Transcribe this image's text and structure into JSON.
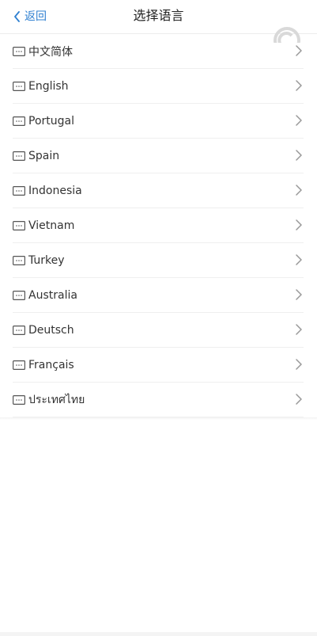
{
  "header": {
    "back_label": "返回",
    "title": "选择语言"
  },
  "languages": [
    {
      "label": "中文简体"
    },
    {
      "label": "English"
    },
    {
      "label": "Portugal"
    },
    {
      "label": "Spain"
    },
    {
      "label": "Indonesia"
    },
    {
      "label": "Vietnam"
    },
    {
      "label": "Turkey"
    },
    {
      "label": "Australia"
    },
    {
      "label": "Deutsch"
    },
    {
      "label": "Français"
    },
    {
      "label": "ประเทศไทย"
    }
  ],
  "colors": {
    "accent": "#2f80d1",
    "text": "#333333",
    "divider": "#efefef",
    "chevron": "#999999"
  },
  "icons": {
    "back": "chevron-left-icon",
    "item": "message-box-icon",
    "item_arrow": "chevron-right-icon"
  }
}
